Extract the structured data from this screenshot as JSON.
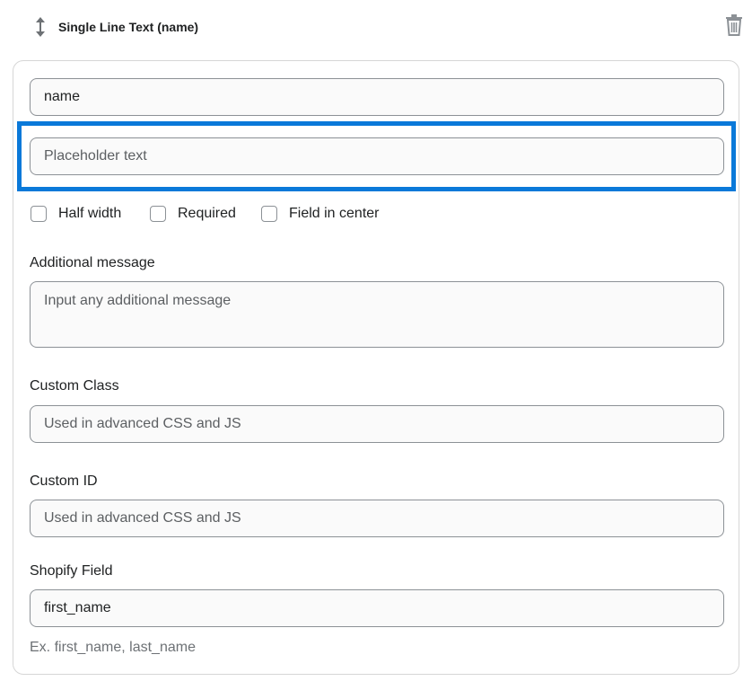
{
  "header": {
    "title": "Single Line Text (name)",
    "drag_icon": "vertical-arrows-icon",
    "delete_icon": "trash-icon"
  },
  "fields": {
    "name_value": "name",
    "placeholder_value": "Placeholder text"
  },
  "checkboxes": [
    {
      "label": "Half width",
      "checked": false
    },
    {
      "label": "Required",
      "checked": false
    },
    {
      "label": "Field in center",
      "checked": false
    }
  ],
  "additional_message": {
    "label": "Additional message",
    "placeholder": "Input any additional message"
  },
  "custom_class": {
    "label": "Custom Class",
    "placeholder": "Used in advanced CSS and JS"
  },
  "custom_id": {
    "label": "Custom ID",
    "placeholder": "Used in advanced CSS and JS"
  },
  "shopify_field": {
    "label": "Shopify Field",
    "value": "first_name",
    "help": "Ex. first_name, last_name"
  },
  "colors": {
    "highlight": "#0a79d9",
    "border": "#8c9196",
    "field_bg": "#fafafa"
  }
}
